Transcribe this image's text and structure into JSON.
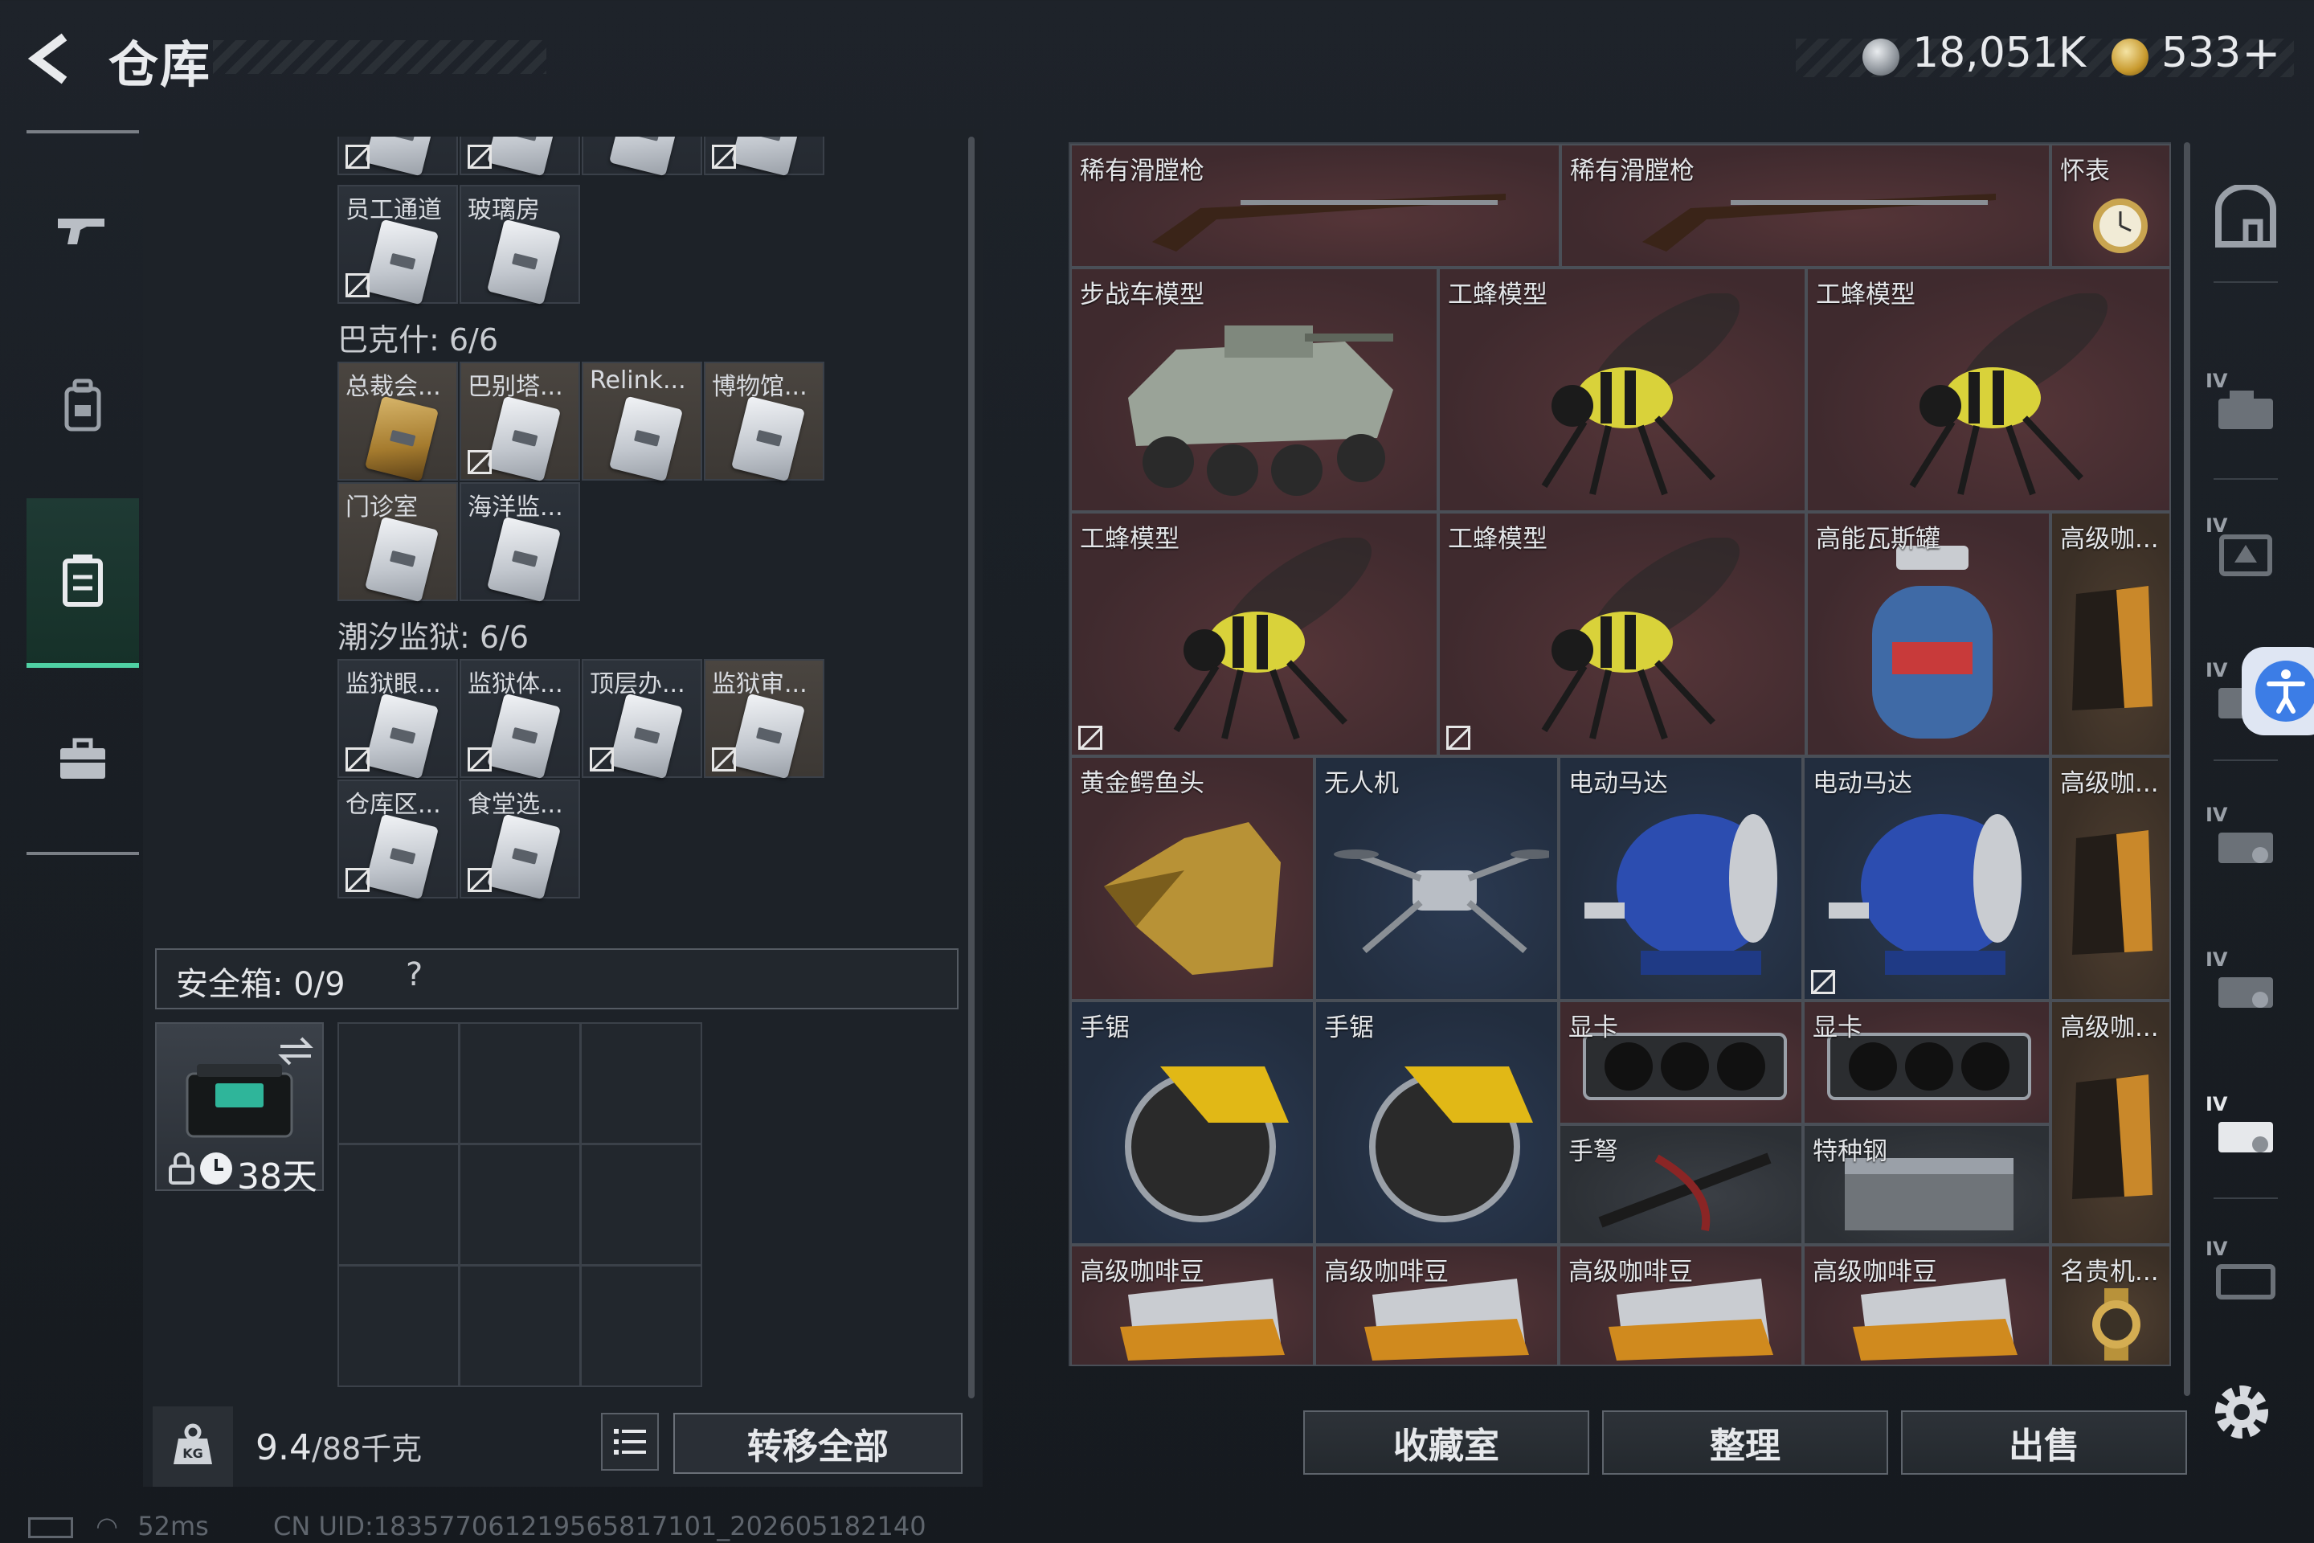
{
  "header": {
    "title": "仓库",
    "currency1_value": "18,051K",
    "currency2_value": "533",
    "currency2_plus": "+"
  },
  "left_nav": {
    "items": [
      {
        "icon": "gun-icon"
      },
      {
        "icon": "backpack-icon"
      },
      {
        "icon": "storage-box-icon",
        "active": true
      },
      {
        "icon": "briefcase-icon"
      }
    ]
  },
  "keys": {
    "top_partial_row": [
      "",
      "",
      "",
      ""
    ],
    "row_a": [
      {
        "label": "员工通道",
        "nodrop": true
      },
      {
        "label": "玻璃房",
        "nodrop": false
      }
    ],
    "group_bakesh": {
      "title": "巴克什: 6/6",
      "items": [
        {
          "label": "总裁会...",
          "gold": true,
          "nodrop": false
        },
        {
          "label": "巴别塔...",
          "gold": true,
          "nodrop": true
        },
        {
          "label": "Relink...",
          "gold": true,
          "nodrop": false
        },
        {
          "label": "博物馆...",
          "gold": true,
          "nodrop": false
        },
        {
          "label": "门诊室",
          "gold": true,
          "nodrop": false
        },
        {
          "label": "海洋监...",
          "gold": false,
          "nodrop": false
        }
      ]
    },
    "group_prison": {
      "title": "潮汐监狱: 6/6",
      "items": [
        {
          "label": "监狱眼...",
          "gold": false,
          "nodrop": true
        },
        {
          "label": "监狱体...",
          "gold": false,
          "nodrop": true
        },
        {
          "label": "顶层办...",
          "gold": false,
          "nodrop": true
        },
        {
          "label": "监狱审...",
          "gold": true,
          "nodrop": true
        },
        {
          "label": "仓库区...",
          "gold": false,
          "nodrop": true
        },
        {
          "label": "食堂选...",
          "gold": false,
          "nodrop": true
        }
      ]
    }
  },
  "safebox": {
    "label": "安全箱: 0/9",
    "help": "?",
    "timer": "38天"
  },
  "footer_left": {
    "weight": "9.4",
    "weight_total": "/88千克",
    "transfer_all": "转移全部"
  },
  "stash": {
    "items": [
      {
        "label": "稀有滑膛枪",
        "art": "musket"
      },
      {
        "label": "稀有滑膛枪",
        "art": "musket"
      },
      {
        "label": "怀表",
        "art": "pocket-watch"
      },
      {
        "label": "步战车模型",
        "art": "ifv"
      },
      {
        "label": "工蜂模型",
        "art": "bee"
      },
      {
        "label": "工蜂模型",
        "art": "bee"
      },
      {
        "label": "工蜂模型",
        "art": "bee"
      },
      {
        "label": "工蜂模型",
        "art": "bee"
      },
      {
        "label": "高能瓦斯罐",
        "art": "gas-tank"
      },
      {
        "label": "高级咖...",
        "art": "coffee-bag"
      },
      {
        "label": "黄金鳄鱼头",
        "art": "croc-head"
      },
      {
        "label": "无人机",
        "art": "drone"
      },
      {
        "label": "电动马达",
        "art": "motor"
      },
      {
        "label": "电动马达",
        "art": "motor"
      },
      {
        "label": "高级咖...",
        "art": "coffee-bag"
      },
      {
        "label": "手锯",
        "art": "saw"
      },
      {
        "label": "手锯",
        "art": "saw"
      },
      {
        "label": "显卡",
        "art": "gpu"
      },
      {
        "label": "显卡",
        "art": "gpu"
      },
      {
        "label": "高级咖...",
        "art": "coffee-bag"
      },
      {
        "label": "手弩",
        "art": "crossbow"
      },
      {
        "label": "特种钢",
        "art": "steel"
      },
      {
        "label": "高级咖啡豆",
        "art": "coffee-box"
      },
      {
        "label": "高级咖啡豆",
        "art": "coffee-box"
      },
      {
        "label": "高级咖啡豆",
        "art": "coffee-box"
      },
      {
        "label": "高级咖啡豆",
        "art": "coffee-box"
      },
      {
        "label": "名贵机...",
        "art": "wristwatch"
      }
    ]
  },
  "bottom_buttons": {
    "collection": "收藏室",
    "organize": "整理",
    "sell": "出售"
  },
  "right_nav": {
    "items": [
      {
        "level": "",
        "icon": "stash-home-icon"
      },
      {
        "level": "IV",
        "icon": "stash-tab-icon"
      },
      {
        "level": "IV",
        "icon": "stash-tab-icon"
      },
      {
        "level": "IV",
        "icon": "stash-tab-icon"
      },
      {
        "level": "IV",
        "icon": "stash-tab-icon"
      },
      {
        "level": "IV",
        "icon": "stash-tab-icon"
      },
      {
        "level": "IV",
        "icon": "stash-tab-icon"
      },
      {
        "level": "IV",
        "icon": "stash-tab-icon"
      }
    ]
  },
  "status": {
    "ping": "52ms",
    "uid": "CN UID:18357706121956581710​1_202605182140"
  }
}
